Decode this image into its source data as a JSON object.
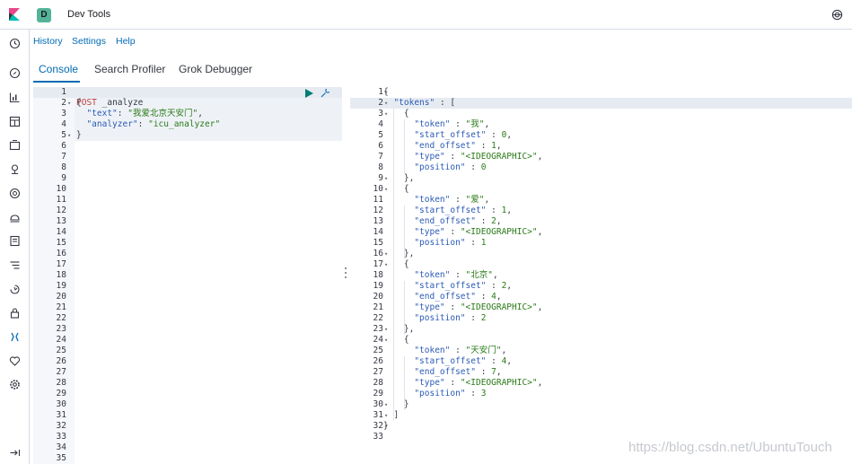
{
  "header": {
    "space_initial": "D",
    "app_title": "Dev Tools"
  },
  "menu": [
    "History",
    "Settings",
    "Help"
  ],
  "tabs": [
    "Console",
    "Search Profiler",
    "Grok Debugger"
  ],
  "left_editor": {
    "line_numbers": [
      "1",
      "2",
      "3",
      "4",
      "5",
      "6",
      "7",
      "8",
      "9",
      "10",
      "11",
      "12",
      "13",
      "14",
      "15",
      "16",
      "17",
      "18",
      "19",
      "20",
      "21",
      "22",
      "23",
      "24",
      "25",
      "26",
      "27",
      "28",
      "29",
      "30",
      "31",
      "32",
      "33",
      "34",
      "35"
    ],
    "method": "POST",
    "endpoint": "_analyze",
    "lines": {
      "l2": "{",
      "l3_key": "\"text\"",
      "l3_val": "\"我爱北京天安门\"",
      "l4_key": "\"analyzer\"",
      "l4_val": "\"icu_analyzer\"",
      "l5": "}"
    }
  },
  "right_editor": {
    "line_numbers": [
      "1",
      "2",
      "3",
      "4",
      "5",
      "6",
      "7",
      "8",
      "9",
      "10",
      "11",
      "12",
      "13",
      "14",
      "15",
      "16",
      "17",
      "18",
      "19",
      "20",
      "21",
      "22",
      "23",
      "24",
      "25",
      "26",
      "27",
      "28",
      "29",
      "30",
      "31",
      "32",
      "33"
    ],
    "root_key": "\"tokens\"",
    "tokens": [
      {
        "token": "\"我\"",
        "start_offset": "0",
        "end_offset": "1",
        "type": "\"<IDEOGRAPHIC>\"",
        "position": "0"
      },
      {
        "token": "\"爱\"",
        "start_offset": "1",
        "end_offset": "2",
        "type": "\"<IDEOGRAPHIC>\"",
        "position": "1"
      },
      {
        "token": "\"北京\"",
        "start_offset": "2",
        "end_offset": "4",
        "type": "\"<IDEOGRAPHIC>\"",
        "position": "2"
      },
      {
        "token": "\"天安门\"",
        "start_offset": "4",
        "end_offset": "7",
        "type": "\"<IDEOGRAPHIC>\"",
        "position": "3"
      }
    ],
    "keys": {
      "token": "\"token\"",
      "start_offset": "\"start_offset\"",
      "end_offset": "\"end_offset\"",
      "type": "\"type\"",
      "position": "\"position\""
    }
  },
  "watermark": "https://blog.csdn.net/UbuntuTouch",
  "colors": {
    "accent": "#006bb4",
    "space_badge": "#54b399",
    "run_button": "#017d73"
  }
}
